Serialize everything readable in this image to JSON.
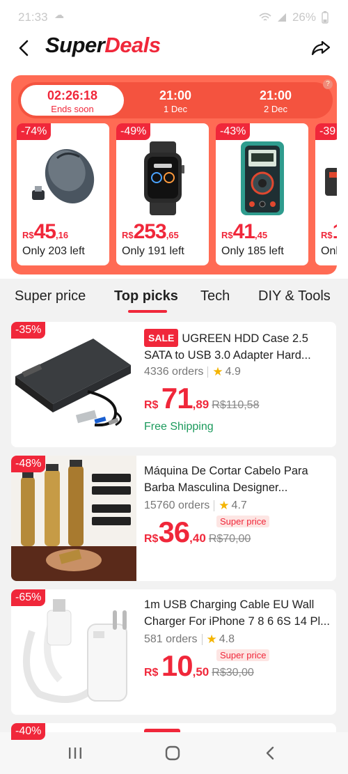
{
  "status": {
    "time": "21:33",
    "battery": "26%"
  },
  "header": {
    "title_part1": "Super",
    "title_part2": "Deals"
  },
  "timer": {
    "slots": [
      {
        "big": "02:26:18",
        "small": "Ends soon"
      },
      {
        "big": "21:00",
        "small": "1 Dec"
      },
      {
        "big": "21:00",
        "small": "2 Dec"
      }
    ],
    "help": "?"
  },
  "deals": [
    {
      "discount": "-74%",
      "currency": "R$",
      "price_int": "45",
      "price_dec": ",16",
      "stock": "Only 203 left",
      "icon": "wireless-mouse-icon"
    },
    {
      "discount": "-49%",
      "currency": "R$",
      "price_int": "253",
      "price_dec": ",65",
      "stock": "Only 191 left",
      "icon": "smartwatch-icon"
    },
    {
      "discount": "-43%",
      "currency": "R$",
      "price_int": "41",
      "price_dec": ",45",
      "stock": "Only 185 left",
      "icon": "multimeter-icon"
    },
    {
      "discount": "-39",
      "currency": "R$",
      "price_int": "1",
      "price_dec": "",
      "stock": "Onl",
      "icon": "product-icon"
    }
  ],
  "tabs": [
    "Super price",
    "Top picks",
    "Tech",
    "DIY & Tools"
  ],
  "products": [
    {
      "discount": "-35%",
      "sale_tag": "SALE",
      "title": "UGREEN HDD Case 2.5 SATA to USB 3.0 Adapter Hard...",
      "orders": "4336 orders",
      "rating": "4.9",
      "currency": "R$",
      "price_int": "71",
      "price_dec": ",89",
      "old_price": "R$110,58",
      "shipping": "Free Shipping"
    },
    {
      "discount": "-48%",
      "title": "Máquina De Cortar Cabelo Para Barba Masculina Designer...",
      "orders": "15760 orders",
      "rating": "4.7",
      "currency": "R$",
      "price_int": "36",
      "price_dec": ",40",
      "old_price": "R$70,00",
      "super_tag": "Super price"
    },
    {
      "discount": "-65%",
      "title": "1m USB Charging Cable EU Wall Charger For iPhone 7 8 6 6S 14 Pl...",
      "orders": "581 orders",
      "rating": "4.8",
      "currency": "R$",
      "price_int": "10",
      "price_dec": ",50",
      "old_price": "R$30,00",
      "super_tag": "Super price"
    },
    {
      "discount": "-40%"
    }
  ],
  "colors": {
    "accent": "#f0273a",
    "panel": "#ff6b54",
    "shipping": "#1b9a5c",
    "star": "#f4b400"
  }
}
